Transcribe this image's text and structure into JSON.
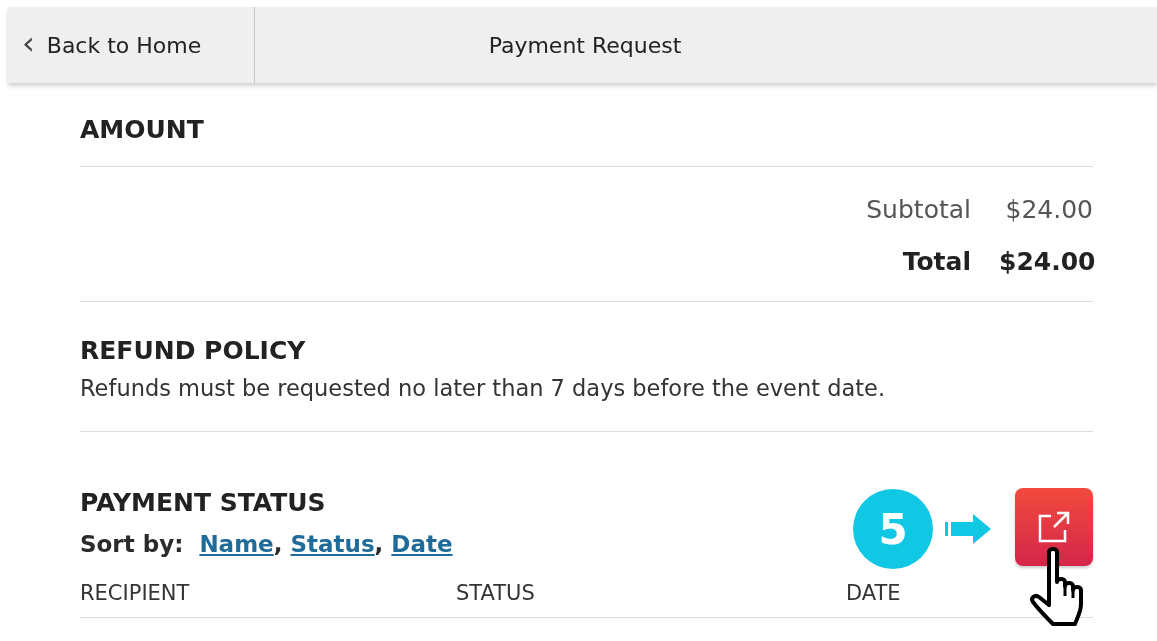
{
  "header": {
    "back_button": {
      "icon": "‹",
      "label": "Back to Home"
    },
    "title": "Payment Request"
  },
  "amount": {
    "heading": "AMOUNT",
    "lines": [
      {
        "label": "Subtotal",
        "value": "$24.00",
        "kind": "normal"
      },
      {
        "label": "Total",
        "value": "$24.00",
        "kind": "total"
      }
    ]
  },
  "refund_policy": {
    "heading": "REFUND POLICY",
    "text": "Refunds must be requested no later than 7 days before the event date."
  },
  "payment_status": {
    "heading": "PAYMENT STATUS",
    "sort_label": "Sort by:",
    "sort_options": [
      {
        "label": "Name",
        "separator": ","
      },
      {
        "label": "Status",
        "separator": ","
      },
      {
        "label": "Date"
      }
    ],
    "step_badge": "5",
    "table": {
      "columns": [
        "RECIPIENT",
        "STATUS",
        "DATE"
      ]
    }
  }
}
